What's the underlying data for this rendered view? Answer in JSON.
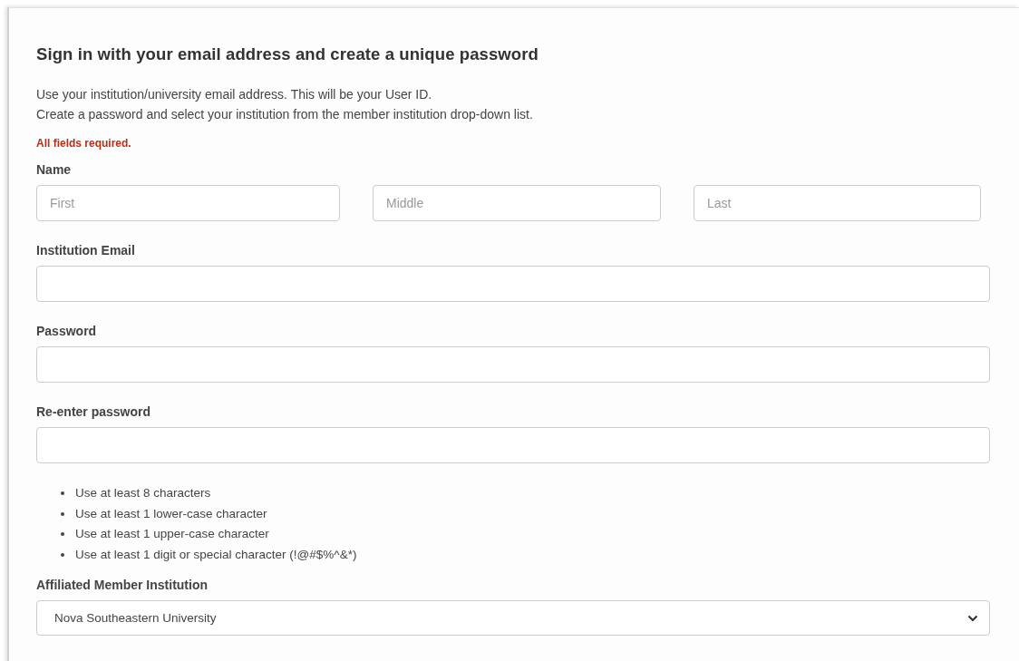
{
  "heading": "Sign in with your email address and create a unique password",
  "intro": [
    "Use your institution/university email address. This will be your User ID.",
    "Create a password and select your institution from the member institution drop-down list."
  ],
  "required_note": "All fields required.",
  "name": {
    "label": "Name",
    "fields": [
      {
        "placeholder": "First"
      },
      {
        "placeholder": "Middle"
      },
      {
        "placeholder": "Last"
      }
    ]
  },
  "email": {
    "label": "Institution Email"
  },
  "password": {
    "label": "Password"
  },
  "reenter_password": {
    "label": "Re-enter password"
  },
  "password_rules": [
    "Use at least 8 characters",
    "Use at least 1 lower-case character",
    "Use at least 1 upper-case character",
    "Use at least 1 digit or special character (!@#$%^&*)"
  ],
  "institution": {
    "label": "Affiliated Member Institution",
    "value": "Nova Southeastern University"
  }
}
